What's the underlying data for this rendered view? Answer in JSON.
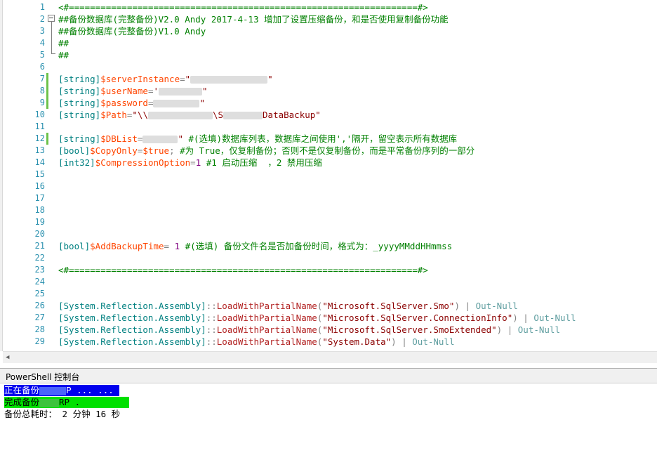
{
  "editor": {
    "lines": [
      {
        "n": "1",
        "changed": false,
        "segs": [
          {
            "c": "cmt",
            "t": "<#==================================================================#>"
          }
        ]
      },
      {
        "n": "2",
        "changed": false,
        "segs": [
          {
            "c": "cmt",
            "t": "##备份数据库(完整备份)V2.0 Andy 2017-4-13 增加了设置压缩备份，和是否使用复制备份功能"
          }
        ]
      },
      {
        "n": "3",
        "changed": false,
        "segs": [
          {
            "c": "cmt",
            "t": "##备份数据库(完整备份)V1.0 Andy"
          }
        ]
      },
      {
        "n": "4",
        "changed": false,
        "segs": [
          {
            "c": "cmt",
            "t": "##"
          }
        ]
      },
      {
        "n": "5",
        "changed": false,
        "segs": [
          {
            "c": "cmt",
            "t": "##"
          }
        ]
      },
      {
        "n": "6",
        "changed": false,
        "segs": []
      },
      {
        "n": "7",
        "changed": true,
        "segs": [
          {
            "c": "typ",
            "t": "[string]"
          },
          {
            "c": "var",
            "t": "$serverInstance"
          },
          {
            "c": "op",
            "t": "="
          },
          {
            "c": "str",
            "t": "\""
          },
          {
            "c": "blur",
            "t": "110"
          },
          {
            "c": "str",
            "t": "\""
          }
        ]
      },
      {
        "n": "8",
        "changed": true,
        "segs": [
          {
            "c": "typ",
            "t": "[string]"
          },
          {
            "c": "var",
            "t": "$userName"
          },
          {
            "c": "op",
            "t": "="
          },
          {
            "c": "str",
            "t": "'"
          },
          {
            "c": "blur",
            "t": "62"
          },
          {
            "c": "str",
            "t": "\""
          }
        ]
      },
      {
        "n": "9",
        "changed": true,
        "segs": [
          {
            "c": "typ",
            "t": "[string]"
          },
          {
            "c": "var",
            "t": "$password"
          },
          {
            "c": "op",
            "t": "="
          },
          {
            "c": "blur",
            "t": "66"
          },
          {
            "c": "str",
            "t": "\""
          }
        ]
      },
      {
        "n": "10",
        "changed": false,
        "segs": [
          {
            "c": "typ",
            "t": "[string]"
          },
          {
            "c": "var",
            "t": "$Path"
          },
          {
            "c": "op",
            "t": "="
          },
          {
            "c": "str",
            "t": "\"\\\\"
          },
          {
            "c": "blur",
            "t": "92"
          },
          {
            "c": "str",
            "t": "\\S"
          },
          {
            "c": "blur",
            "t": "56"
          },
          {
            "c": "str",
            "t": "DataBackup\""
          }
        ]
      },
      {
        "n": "11",
        "changed": false,
        "segs": []
      },
      {
        "n": "12",
        "changed": true,
        "segs": [
          {
            "c": "typ",
            "t": "[string]"
          },
          {
            "c": "var",
            "t": "$DBList"
          },
          {
            "c": "op",
            "t": "="
          },
          {
            "c": "blur",
            "t": "50"
          },
          {
            "c": "str",
            "t": "\""
          },
          {
            "c": "op",
            "t": " "
          },
          {
            "c": "cmt",
            "t": "#(选填)数据库列表，数据库之间使用','隔开，留空表示所有数据库"
          }
        ]
      },
      {
        "n": "13",
        "changed": false,
        "segs": [
          {
            "c": "typ",
            "t": "[bool]"
          },
          {
            "c": "var",
            "t": "$CopyOnly"
          },
          {
            "c": "op",
            "t": "="
          },
          {
            "c": "var",
            "t": "$true"
          },
          {
            "c": "op",
            "t": "; "
          },
          {
            "c": "cmt",
            "t": "#为 True，仅复制备份；否则不是仅复制备份，而是平常备份序列的一部分"
          }
        ]
      },
      {
        "n": "14",
        "changed": false,
        "segs": [
          {
            "c": "typ",
            "t": "[int32]"
          },
          {
            "c": "var",
            "t": "$CompressionOption"
          },
          {
            "c": "op",
            "t": "="
          },
          {
            "c": "num",
            "t": "1"
          },
          {
            "c": "op",
            "t": " "
          },
          {
            "c": "cmt",
            "t": "#1 启动压缩  ，2 禁用压缩"
          }
        ]
      },
      {
        "n": "15",
        "changed": false,
        "segs": []
      },
      {
        "n": "16",
        "changed": false,
        "segs": []
      },
      {
        "n": "17",
        "changed": false,
        "segs": []
      },
      {
        "n": "18",
        "changed": false,
        "segs": []
      },
      {
        "n": "19",
        "changed": false,
        "segs": []
      },
      {
        "n": "20",
        "changed": false,
        "segs": []
      },
      {
        "n": "21",
        "changed": false,
        "segs": [
          {
            "c": "typ",
            "t": "[bool]"
          },
          {
            "c": "var",
            "t": "$AddBackupTime"
          },
          {
            "c": "op",
            "t": "= "
          },
          {
            "c": "num",
            "t": "1"
          },
          {
            "c": "op",
            "t": " "
          },
          {
            "c": "cmt",
            "t": "#(选填) 备份文件名是否加备份时间，格式为：_yyyyMMddHHmmss"
          }
        ]
      },
      {
        "n": "22",
        "changed": false,
        "segs": []
      },
      {
        "n": "23",
        "changed": false,
        "segs": [
          {
            "c": "cmt",
            "t": "<#==================================================================#>"
          }
        ]
      },
      {
        "n": "24",
        "changed": false,
        "segs": []
      },
      {
        "n": "25",
        "changed": false,
        "segs": []
      },
      {
        "n": "26",
        "changed": false,
        "segs": [
          {
            "c": "typ",
            "t": "[System.Reflection.Assembly]"
          },
          {
            "c": "op",
            "t": "::"
          },
          {
            "c": "met",
            "t": "LoadWithPartialName"
          },
          {
            "c": "op",
            "t": "("
          },
          {
            "c": "str",
            "t": "\"Microsoft.SqlServer.Smo\""
          },
          {
            "c": "op",
            "t": ") | "
          },
          {
            "c": "cmd",
            "t": "Out-Null"
          }
        ]
      },
      {
        "n": "27",
        "changed": false,
        "segs": [
          {
            "c": "typ",
            "t": "[System.Reflection.Assembly]"
          },
          {
            "c": "op",
            "t": "::"
          },
          {
            "c": "met",
            "t": "LoadWithPartialName"
          },
          {
            "c": "op",
            "t": "("
          },
          {
            "c": "str",
            "t": "\"Microsoft.SqlServer.ConnectionInfo\""
          },
          {
            "c": "op",
            "t": ") | "
          },
          {
            "c": "cmd",
            "t": "Out-Null"
          }
        ]
      },
      {
        "n": "28",
        "changed": false,
        "segs": [
          {
            "c": "typ",
            "t": "[System.Reflection.Assembly]"
          },
          {
            "c": "op",
            "t": "::"
          },
          {
            "c": "met",
            "t": "LoadWithPartialName"
          },
          {
            "c": "op",
            "t": "("
          },
          {
            "c": "str",
            "t": "\"Microsoft.SqlServer.SmoExtended\""
          },
          {
            "c": "op",
            "t": ") | "
          },
          {
            "c": "cmd",
            "t": "Out-Null"
          }
        ]
      },
      {
        "n": "29",
        "changed": false,
        "segs": [
          {
            "c": "typ",
            "t": "[System.Reflection.Assembly]"
          },
          {
            "c": "op",
            "t": "::"
          },
          {
            "c": "met",
            "t": "LoadWithPartialName"
          },
          {
            "c": "op",
            "t": "("
          },
          {
            "c": "str",
            "t": "\"System.Data\""
          },
          {
            "c": "op",
            "t": ") | "
          },
          {
            "c": "cmd",
            "t": "Out-Null"
          }
        ]
      }
    ]
  },
  "console": {
    "title": "PowerShell 控制台",
    "line1_prefix": "正在备份",
    "line1_suffix": "P ... ...",
    "line2_prefix": "完成备份",
    "line2_suffix": "RP .",
    "line3": "备份总耗时： 2 分钟 16 秒"
  },
  "colors": {
    "line_number": "#2b91af",
    "comment": "#008000",
    "type": "#008080",
    "variable": "#ff4500",
    "string": "#8b0000",
    "console_progress_bg": "#0000ee",
    "console_done_bg": "#00e000"
  },
  "icons": {
    "fold": "fold-collapse-icon",
    "scroll_left": "scroll-left-arrow-icon"
  }
}
